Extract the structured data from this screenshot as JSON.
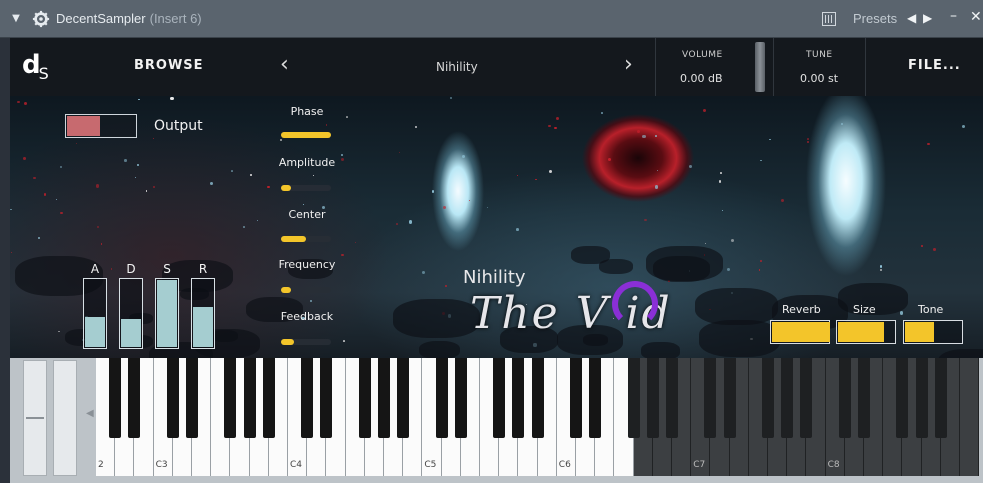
{
  "window": {
    "menu_arrow": "▼",
    "title": "DecentSampler",
    "insert": "(Insert 6)",
    "presets_label": "Presets",
    "nav_prev": "◀",
    "nav_next": "▶",
    "minimize": "–",
    "close": "✕"
  },
  "header": {
    "logo_main": "d",
    "logo_sub": "S",
    "browse": "BROWSE",
    "prev": "‹",
    "preset_name": "Nihility",
    "next": "›",
    "volume_label": "VOLUME",
    "volume_value": "0.00 dB",
    "tune_label": "TUNE",
    "tune_value": "0.00 st",
    "file": "FILE..."
  },
  "output": {
    "label": "Output",
    "level": 0.48
  },
  "lfo": [
    {
      "label": "Phase",
      "value": 1.0
    },
    {
      "label": "Amplitude",
      "value": 0.2
    },
    {
      "label": "Center",
      "value": 0.5
    },
    {
      "label": "Frequency",
      "value": 0.2
    },
    {
      "label": "Feedback",
      "value": 0.25
    }
  ],
  "adsr": [
    {
      "label": "A",
      "value": 0.45
    },
    {
      "label": "D",
      "value": 0.42
    },
    {
      "label": "S",
      "value": 1.0
    },
    {
      "label": "R",
      "value": 0.6
    }
  ],
  "title_art": {
    "small": "Nihility",
    "big": "The V  id"
  },
  "fx": [
    {
      "label": "Reverb",
      "value": 1.0
    },
    {
      "label": "Size",
      "value": 0.8
    },
    {
      "label": "Tone",
      "value": 0.5
    }
  ],
  "keyboard": {
    "octave_labels": [
      "2",
      "C3",
      "C4",
      "C5",
      "C6",
      "C7",
      "C8"
    ],
    "active_until_label": "C6",
    "range_marker": "◀"
  },
  "colors": {
    "accent": "#f3c52a",
    "output_fill": "#c76a6f",
    "adsr_fill": "#a5cdd0",
    "void_ring": "#8a2fd6"
  }
}
